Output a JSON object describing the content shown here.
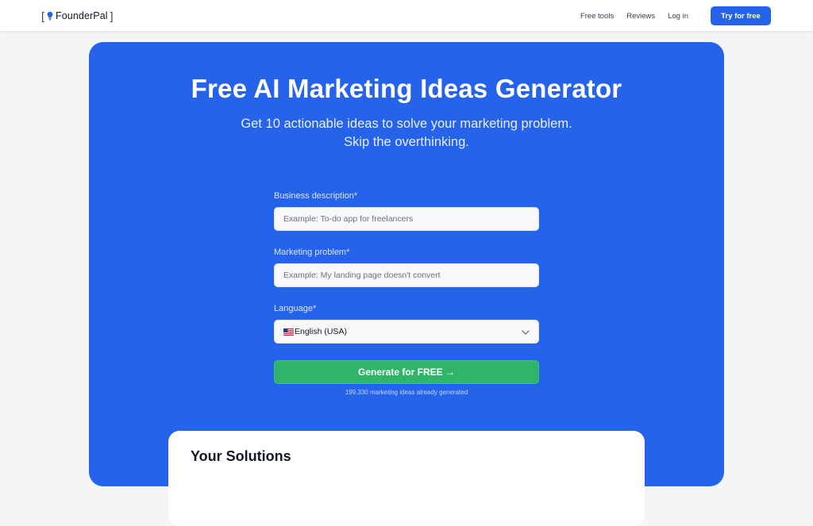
{
  "nav": {
    "logo_text": "FounderPal",
    "links": [
      "Free tools",
      "Reviews",
      "Log in"
    ],
    "cta": "Try for free"
  },
  "hero": {
    "title": "Free AI Marketing Ideas Generator",
    "subtitle_line1": "Get 10 actionable ideas to solve your marketing problem.",
    "subtitle_line2": "Skip the overthinking."
  },
  "form": {
    "business": {
      "label": "Business description*",
      "placeholder": "Example: To-do app for freelancers",
      "value": ""
    },
    "problem": {
      "label": "Marketing problem*",
      "placeholder": "Example: My landing page doesn't convert",
      "value": ""
    },
    "language": {
      "label": "Language*",
      "selected": "English (USA)",
      "flag_icon": "us-flag-icon"
    },
    "generate_label": "Generate for FREE →",
    "generated_count": "199,330 marketing ideas already generated"
  },
  "solutions": {
    "title": "Your Solutions"
  },
  "colors": {
    "brand": "#2563eb",
    "cta_green": "#2fb56a"
  }
}
